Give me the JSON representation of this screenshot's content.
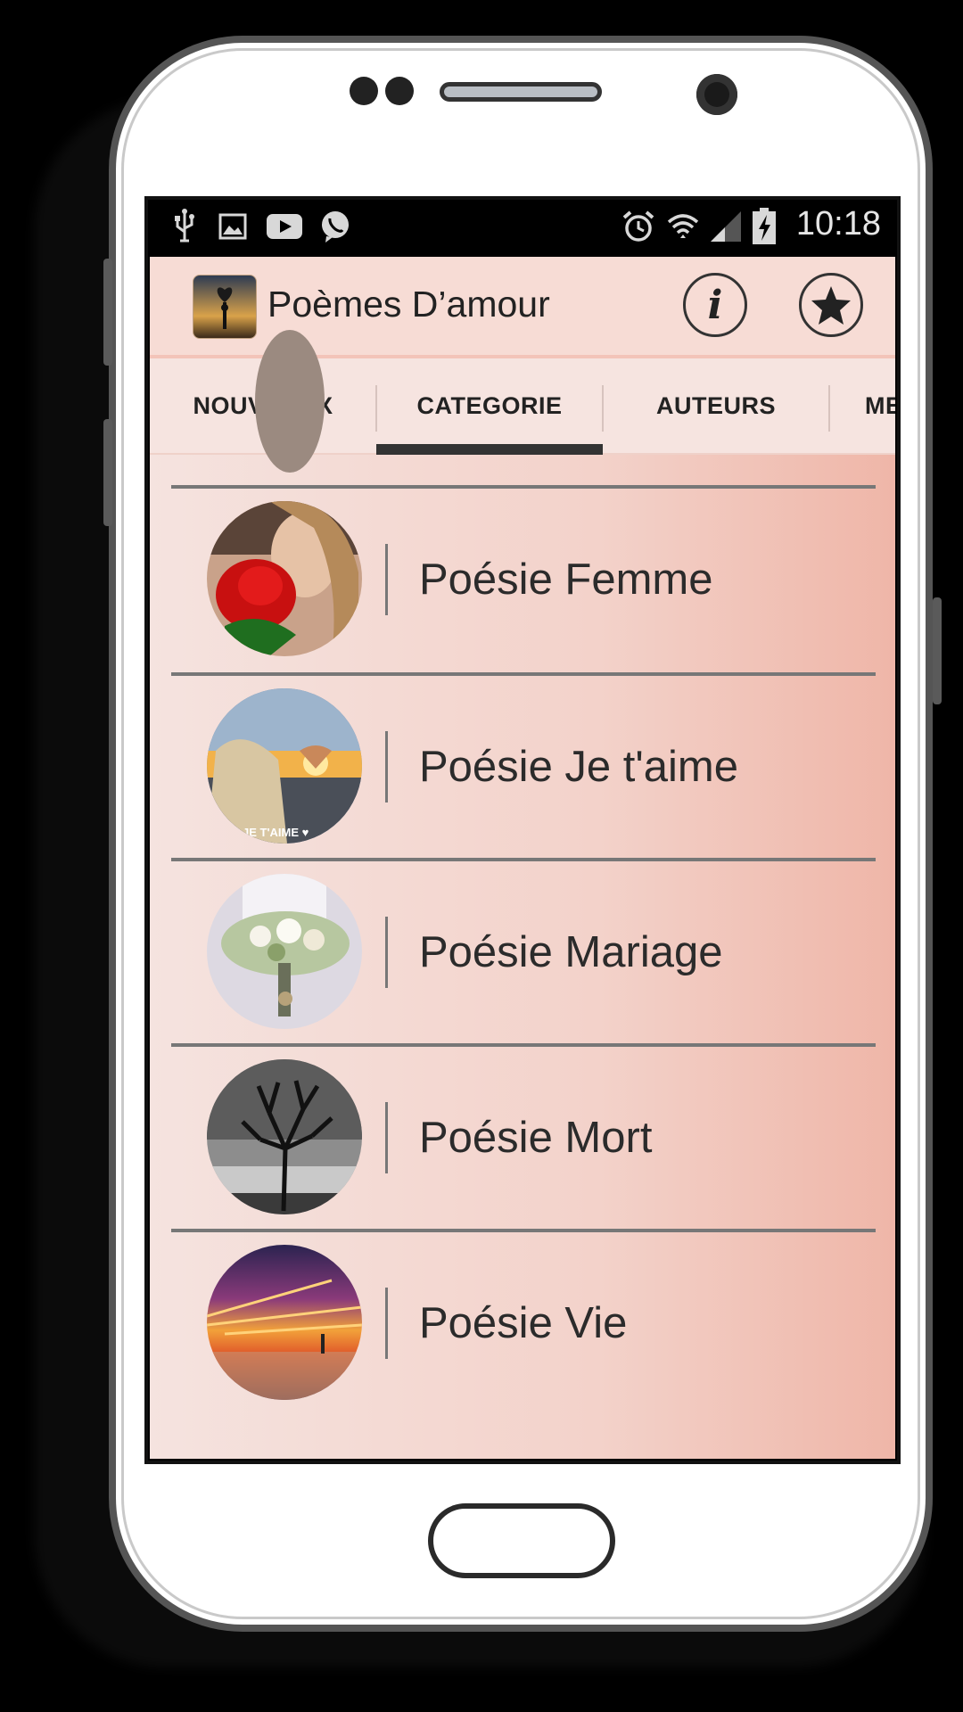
{
  "status_bar": {
    "time": "10:18",
    "left_icons": [
      "usb-icon",
      "image-icon",
      "youtube-icon",
      "viber-icon"
    ],
    "right_icons": [
      "alarm-icon",
      "wifi-icon",
      "signal-icon",
      "battery-charging-icon"
    ]
  },
  "app_bar": {
    "title": "Poèmes D’amour",
    "info_label": "i",
    "actions": [
      "info-icon",
      "star-icon"
    ]
  },
  "tabs": [
    {
      "label": "NOUVEAUX",
      "active": false
    },
    {
      "label": "CATEGORIE",
      "active": true
    },
    {
      "label": "AUTEURS",
      "active": false
    },
    {
      "label": "ME",
      "active": false
    }
  ],
  "categories": [
    {
      "label": "Poésie Femme",
      "image": "woman-rose-photo"
    },
    {
      "label": "Poésie Je t'aime",
      "image": "heart-hands-sunset-photo",
      "image_caption": "JE T'AIME ♥"
    },
    {
      "label": "Poésie Mariage",
      "image": "wedding-bouquet-photo"
    },
    {
      "label": "Poésie Mort",
      "image": "dead-tree-photo"
    },
    {
      "label": "Poésie Vie",
      "image": "sunset-sky-photo"
    }
  ],
  "colors": {
    "accent_indicator": "#333333",
    "background_start": "#f5e3df",
    "background_end": "#efb6a8"
  }
}
